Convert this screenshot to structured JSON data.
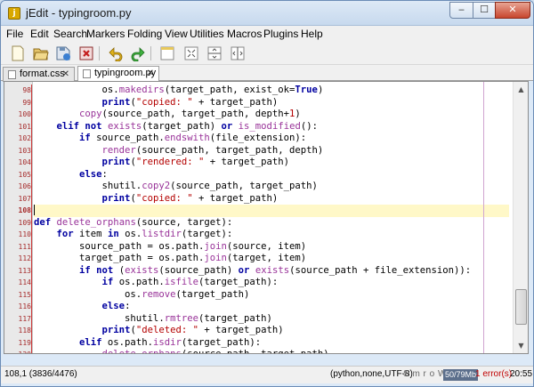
{
  "window": {
    "title": "jEdit - typingroom.py",
    "app_icon": "jedit-app-icon",
    "controls": {
      "minimize": "‒",
      "maximize": "☐",
      "close": "✕"
    }
  },
  "menubar": {
    "items": [
      "File",
      "Edit",
      "Search",
      "Markers",
      "Folding",
      "View",
      "Utilities",
      "Macros",
      "Plugins",
      "Help"
    ]
  },
  "toolbar": {
    "buttons": [
      "new-file-icon",
      "open-file-icon",
      "save-file-icon",
      "close-file-icon",
      "undo-icon",
      "redo-icon",
      "new-view-icon",
      "unsplit-icon",
      "split-horizontal-icon",
      "split-vertical-icon"
    ]
  },
  "tabs": [
    {
      "label": "format.css",
      "close": "✕",
      "active": false
    },
    {
      "label": "typingroom.py",
      "close": "✕",
      "active": true
    }
  ],
  "editor": {
    "current_line": "108",
    "gutter": [
      "98",
      "99",
      "100",
      "101",
      "102",
      "103",
      "104",
      "105",
      "106",
      "107",
      "108",
      "109",
      "110",
      "111",
      "112",
      "113",
      "114",
      "115",
      "116",
      "117",
      "118",
      "119",
      "120",
      "121"
    ],
    "code": [
      [
        [
          "",
          "            "
        ],
        [
          "",
          "os."
        ],
        [
          "fn",
          "makedirs"
        ],
        [
          "",
          "(target_path, exist_ok="
        ],
        [
          "kw",
          "True"
        ],
        [
          "",
          ")"
        ]
      ],
      [
        [
          "",
          "            "
        ],
        [
          "kw",
          "print"
        ],
        [
          "",
          "("
        ],
        [
          "str",
          "\"copied: \""
        ],
        [
          "",
          " + target_path)"
        ]
      ],
      [
        [
          "",
          "        "
        ],
        [
          "fn",
          "copy"
        ],
        [
          "",
          "(source_path, target_path, depth+"
        ],
        [
          "num",
          "1"
        ],
        [
          "",
          ")"
        ]
      ],
      [
        [
          "",
          "    "
        ],
        [
          "kw",
          "elif not"
        ],
        [
          "",
          " "
        ],
        [
          "fn",
          "exists"
        ],
        [
          "",
          "(target_path) "
        ],
        [
          "kw",
          "or"
        ],
        [
          "",
          " "
        ],
        [
          "fn",
          "is_modified"
        ],
        [
          "",
          "():"
        ]
      ],
      [
        [
          "",
          "        "
        ],
        [
          "kw",
          "if"
        ],
        [
          "",
          " source_path."
        ],
        [
          "fn",
          "endswith"
        ],
        [
          "",
          "(file_extension):"
        ]
      ],
      [
        [
          "",
          "            "
        ],
        [
          "fn",
          "render"
        ],
        [
          "",
          "(source_path, target_path, depth)"
        ]
      ],
      [
        [
          "",
          "            "
        ],
        [
          "kw",
          "print"
        ],
        [
          "",
          "("
        ],
        [
          "str",
          "\"rendered: \""
        ],
        [
          "",
          " + target_path)"
        ]
      ],
      [
        [
          "",
          "        "
        ],
        [
          "kw",
          "else"
        ],
        [
          "",
          ":"
        ]
      ],
      [
        [
          "",
          "            shutil."
        ],
        [
          "fn",
          "copy2"
        ],
        [
          "",
          "(source_path, target_path)"
        ]
      ],
      [
        [
          "",
          "            "
        ],
        [
          "kw",
          "print"
        ],
        [
          "",
          "("
        ],
        [
          "str",
          "\"copied: \""
        ],
        [
          "",
          " + target_path)"
        ]
      ],
      [],
      [
        [
          "kw",
          "def"
        ],
        [
          "",
          " "
        ],
        [
          "fn",
          "delete_orphans"
        ],
        [
          "",
          "(source, target):"
        ]
      ],
      [
        [
          "",
          "    "
        ],
        [
          "kw",
          "for"
        ],
        [
          "",
          " item "
        ],
        [
          "kw",
          "in"
        ],
        [
          "",
          " os."
        ],
        [
          "fn",
          "listdir"
        ],
        [
          "",
          "(target):"
        ]
      ],
      [
        [
          "",
          "        source_path = os.path."
        ],
        [
          "fn",
          "join"
        ],
        [
          "",
          "(source, item)"
        ]
      ],
      [
        [
          "",
          "        target_path = os.path."
        ],
        [
          "fn",
          "join"
        ],
        [
          "",
          "(target, item)"
        ]
      ],
      [
        [
          "",
          "        "
        ],
        [
          "kw",
          "if not"
        ],
        [
          "",
          " ("
        ],
        [
          "fn",
          "exists"
        ],
        [
          "",
          "(source_path) "
        ],
        [
          "kw",
          "or"
        ],
        [
          "",
          " "
        ],
        [
          "fn",
          "exists"
        ],
        [
          "",
          "(source_path + file_extension)):"
        ]
      ],
      [
        [
          "",
          "            "
        ],
        [
          "kw",
          "if"
        ],
        [
          "",
          " os.path."
        ],
        [
          "fn",
          "isfile"
        ],
        [
          "",
          "(target_path):"
        ]
      ],
      [
        [
          "",
          "                os."
        ],
        [
          "fn",
          "remove"
        ],
        [
          "",
          "(target_path)"
        ]
      ],
      [
        [
          "",
          "            "
        ],
        [
          "kw",
          "else"
        ],
        [
          "",
          ":"
        ]
      ],
      [
        [
          "",
          "                shutil."
        ],
        [
          "fn",
          "rmtree"
        ],
        [
          "",
          "(target_path)"
        ]
      ],
      [
        [
          "",
          "            "
        ],
        [
          "kw",
          "print"
        ],
        [
          "",
          "("
        ],
        [
          "str",
          "\"deleted: \""
        ],
        [
          "",
          " + target_path)"
        ]
      ],
      [
        [
          "",
          "        "
        ],
        [
          "kw",
          "elif"
        ],
        [
          "",
          " os.path."
        ],
        [
          "fn",
          "isdir"
        ],
        [
          "",
          "(target_path):"
        ]
      ],
      [
        [
          "",
          "            "
        ],
        [
          "fn",
          "delete_orphans"
        ],
        [
          "",
          "(source_path, target_path)"
        ]
      ],
      []
    ]
  },
  "statusbar": {
    "caret": "108,1 (3836/4476)",
    "mode": "(python,none,UTF-8)",
    "flags": "S m r o W G",
    "memory": "50/79Mb",
    "errors": "1 error(s)",
    "clock": "20:55"
  },
  "colors": {
    "keyword": "#0000a0",
    "function": "#993399",
    "string": "#b40000",
    "line_number": "#a52a2a",
    "current_line": "#fff8c8",
    "wrap_guide": "#d0a4d0"
  }
}
